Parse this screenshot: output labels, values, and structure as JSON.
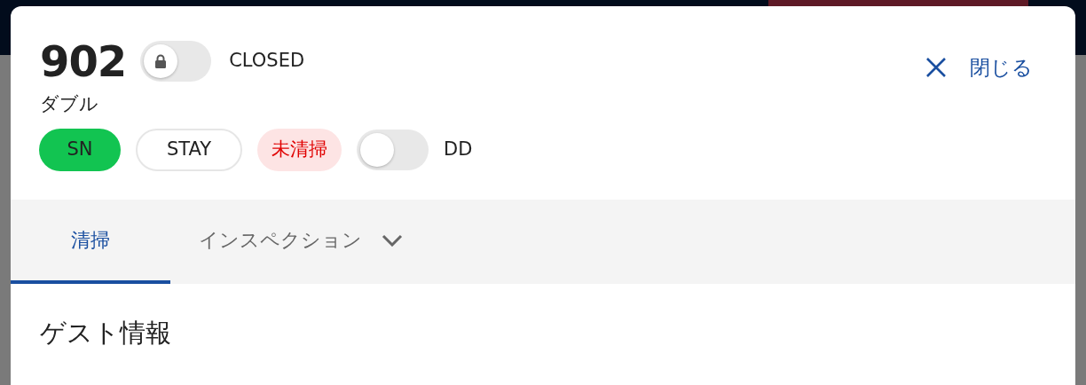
{
  "room": {
    "number": "902",
    "lock_toggle": {
      "on": false
    },
    "status": "CLOSED",
    "type": "ダブル"
  },
  "close": {
    "label": "閉じる"
  },
  "tags": [
    {
      "label": "SN",
      "kind": "success"
    },
    {
      "label": "STAY",
      "kind": "outline"
    },
    {
      "label": "未清掃",
      "kind": "danger"
    }
  ],
  "dd_toggle": {
    "on": false,
    "label": "DD"
  },
  "tabs": [
    {
      "label": "清掃",
      "selected": true,
      "dropdown": false
    },
    {
      "label": "インスペクション",
      "selected": false,
      "dropdown": true
    }
  ],
  "section": {
    "title": "ゲスト情報"
  }
}
